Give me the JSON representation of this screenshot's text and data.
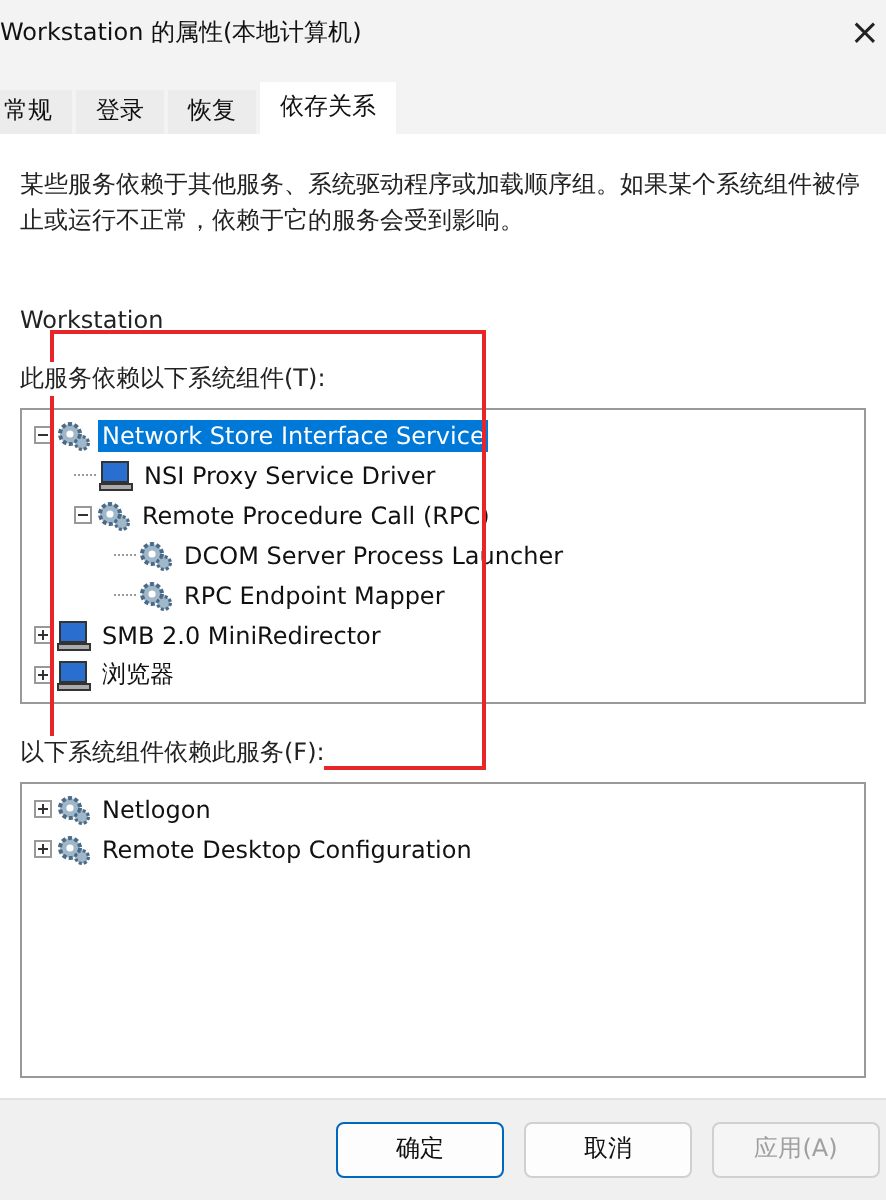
{
  "window": {
    "title": "Workstation 的属性(本地计算机)",
    "close": "×"
  },
  "tabs": [
    {
      "label": "常规",
      "selected": false
    },
    {
      "label": "登录",
      "selected": false
    },
    {
      "label": "恢复",
      "selected": false
    },
    {
      "label": "依存关系",
      "selected": true
    }
  ],
  "description": "某些服务依赖于其他服务、系统驱动程序或加载顺序组。如果某个系统组件被停止或运行不正常，依赖于它的服务会受到影响。",
  "service_name": "Workstation",
  "depends_on": {
    "label": "此服务依赖以下系统组件(T):",
    "items": [
      {
        "name": "Network Store Interface Service",
        "kind": "service",
        "expanded": true,
        "selected": true,
        "children": [
          {
            "name": "NSI Proxy Service Driver",
            "kind": "driver",
            "selected": false
          },
          {
            "name": "Remote Procedure Call (RPC)",
            "kind": "service",
            "expanded": true,
            "selected": false,
            "children": [
              {
                "name": "DCOM Server Process Launcher",
                "kind": "service",
                "selected": false
              },
              {
                "name": "RPC Endpoint Mapper",
                "kind": "service",
                "selected": false
              }
            ]
          }
        ]
      },
      {
        "name": "SMB 2.0 MiniRedirector",
        "kind": "driver",
        "expanded": false,
        "selected": false
      },
      {
        "name": "浏览器",
        "kind": "driver",
        "expanded": false,
        "selected": false
      }
    ]
  },
  "dependents": {
    "label": "以下系统组件依赖此服务(F):",
    "items": [
      {
        "name": "Netlogon",
        "kind": "service",
        "expanded": false,
        "selected": false
      },
      {
        "name": "Remote Desktop Configuration",
        "kind": "service",
        "expanded": false,
        "selected": false
      }
    ]
  },
  "buttons": [
    {
      "label": "确定",
      "kind": "default",
      "disabled": false
    },
    {
      "label": "取消",
      "kind": "normal",
      "disabled": false
    },
    {
      "label": "应用(A)",
      "kind": "normal",
      "disabled": true
    }
  ]
}
